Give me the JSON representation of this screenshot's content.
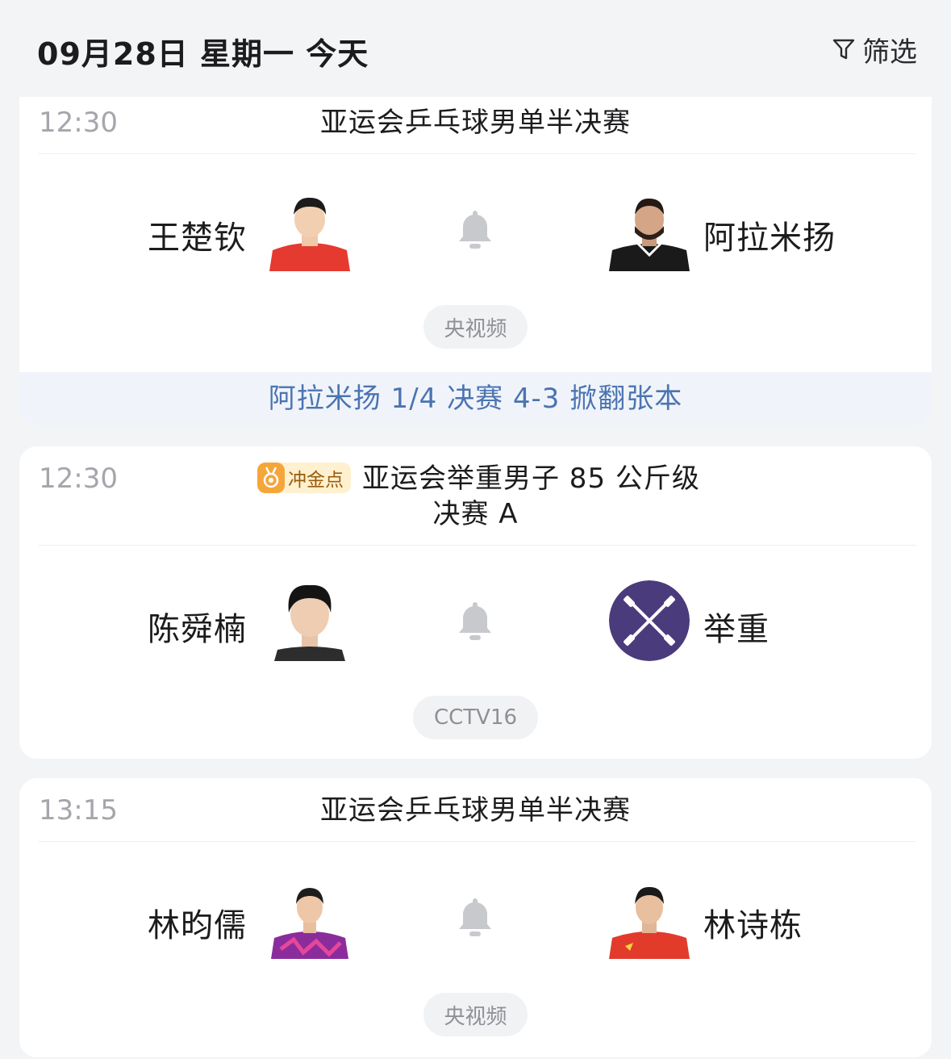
{
  "header": {
    "date_title": "09月28日 星期一 今天",
    "filter_label": "筛选"
  },
  "matches": [
    {
      "time": "12:30",
      "title": "亚运会乒乓球男单半决赛",
      "home": {
        "name": "王楚钦",
        "avatar": "player-photo"
      },
      "away": {
        "name": "阿拉米扬",
        "avatar": "player-photo"
      },
      "channel": "央视频",
      "news": "阿拉米扬 1/4 决赛 4-3 掀翻张本"
    },
    {
      "time": "12:30",
      "badge": "冲金点",
      "title_line1": "亚运会举重男子 85 公斤级",
      "title_line2": "决赛 A",
      "home": {
        "name": "陈舜楠",
        "avatar": "player-photo"
      },
      "away": {
        "name": "举重",
        "avatar": "weightlifting-icon"
      },
      "channel": "CCTV16"
    },
    {
      "time": "13:15",
      "title": "亚运会乒乓球男单半决赛",
      "home": {
        "name": "林昀儒",
        "avatar": "player-photo"
      },
      "away": {
        "name": "林诗栋",
        "avatar": "player-photo"
      },
      "channel": "央视频"
    }
  ],
  "colors": {
    "background": "#f3f4f6",
    "card": "#ffffff",
    "news_text": "#4b74b1",
    "time_text": "#a4a6ab",
    "bell": "#c8c9cc",
    "weightlifting_bg": "#4a3b7c",
    "badge_bg": "#fff1cf",
    "badge_text": "#9b5b0c"
  }
}
